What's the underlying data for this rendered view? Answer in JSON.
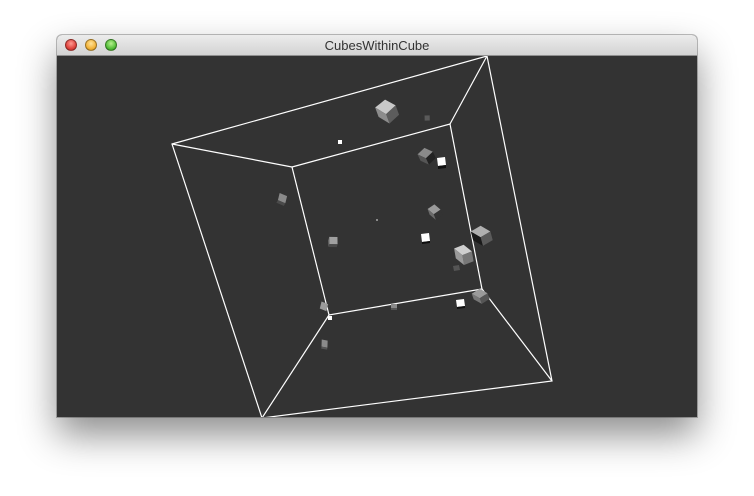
{
  "window": {
    "title": "CubesWithinCube",
    "background_color": "#333333"
  },
  "controls": {
    "close": "close-icon",
    "minimize": "minimize-icon",
    "zoom": "zoom-icon"
  },
  "scene": {
    "wireframe_color": "#ffffff",
    "cube_colors": [
      "#ffffff",
      "#a8a8a8",
      "#6e6e6e",
      "#1a1a1a"
    ]
  }
}
